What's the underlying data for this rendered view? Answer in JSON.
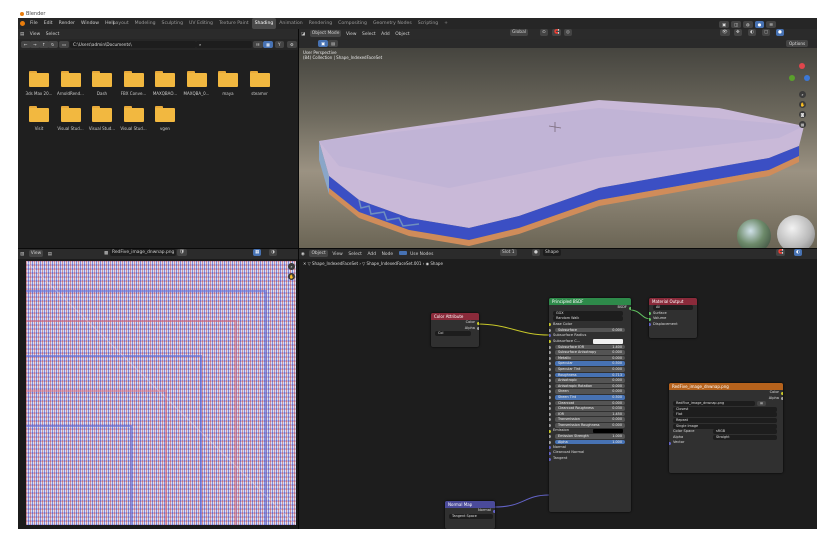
{
  "window": {
    "title": "Blender"
  },
  "menu": [
    "File",
    "Edit",
    "Render",
    "Window",
    "Help"
  ],
  "workspaces": [
    "Layout",
    "Modeling",
    "Sculpting",
    "UV Editing",
    "Texture Paint",
    "Shading",
    "Animation",
    "Rendering",
    "Compositing",
    "Geometry Nodes",
    "Scripting",
    "+"
  ],
  "active_workspace_index": 5,
  "file_browser": {
    "menu": [
      "View",
      "Select"
    ],
    "path": "C:\\Users\\admin\\Documents\\",
    "folders_row1": [
      "3ds Max 20...",
      "ArnoldRend...",
      "Dash",
      "FBX Conve...",
      "MAXQBAO...",
      "MAXQBA_0...",
      "maya",
      "steamvr"
    ],
    "folders_row2": [
      "Visit",
      "Visual Stud...",
      "Visual Stud...",
      "Visual Stud...",
      "vgen"
    ]
  },
  "viewport": {
    "mode": "Object Mode",
    "menu": [
      "View",
      "Select",
      "Add",
      "Object"
    ],
    "overlay_line1": "User Perspective",
    "overlay_line2": "(84) Collection | Shape_IndexedFaceSet",
    "global_label": "Global",
    "options_label": "Options"
  },
  "image_editor": {
    "view_label": "View",
    "image_name": "RedFive_image_dnwnap.png"
  },
  "node_editor": {
    "object_label": "Object",
    "menu": [
      "View",
      "Select",
      "Add",
      "Node"
    ],
    "use_nodes_label": "Use Nodes",
    "slot_label": "Slot 1",
    "material_label": "Shape",
    "breadcrumb": [
      "Shape_IndexedFaceSet",
      "Shape_IndexedFaceSet.001",
      "Shape"
    ],
    "color_attribute": {
      "title": "Color Attribute",
      "outputs": [
        "Color",
        "Alpha"
      ],
      "field": "Col"
    },
    "principled": {
      "title": "Principled BSDF",
      "output": "BSDF",
      "dropdowns": [
        "GGX",
        "Random Walk"
      ],
      "rows": [
        {
          "label": "Base Color",
          "kind": "socket"
        },
        {
          "label": "Subsurface",
          "value": "0.000",
          "kind": "slider"
        },
        {
          "label": "Subsurface Radius",
          "kind": "socket"
        },
        {
          "label": "Subsurface C...",
          "kind": "color"
        },
        {
          "label": "Subsurface IOR",
          "value": "1.400",
          "kind": "slider"
        },
        {
          "label": "Subsurface Anisotropy",
          "value": "0.000",
          "kind": "slider"
        },
        {
          "label": "Metallic",
          "value": "0.000",
          "kind": "slider"
        },
        {
          "label": "Specular",
          "value": "0.500",
          "kind": "slider",
          "hl": true
        },
        {
          "label": "Specular Tint",
          "value": "0.000",
          "kind": "slider"
        },
        {
          "label": "Roughness",
          "value": "0.713",
          "kind": "slider",
          "hl": true
        },
        {
          "label": "Anisotropic",
          "value": "0.000",
          "kind": "slider"
        },
        {
          "label": "Anisotropic Rotation",
          "value": "0.000",
          "kind": "slider"
        },
        {
          "label": "Sheen",
          "value": "0.000",
          "kind": "slider"
        },
        {
          "label": "Sheen Tint",
          "value": "0.500",
          "kind": "slider",
          "hl": true
        },
        {
          "label": "Clearcoat",
          "value": "0.000",
          "kind": "slider"
        },
        {
          "label": "Clearcoat Roughness",
          "value": "0.030",
          "kind": "slider"
        },
        {
          "label": "IOR",
          "value": "1.450",
          "kind": "slider"
        },
        {
          "label": "Transmission",
          "value": "0.000",
          "kind": "slider"
        },
        {
          "label": "Transmission Roughness",
          "value": "0.000",
          "kind": "slider"
        },
        {
          "label": "Emission",
          "kind": "color-dark"
        },
        {
          "label": "Emission Strength",
          "value": "1.000",
          "kind": "slider"
        },
        {
          "label": "Alpha",
          "value": "1.000",
          "kind": "slider",
          "hl": true
        },
        {
          "label": "Normal",
          "kind": "socket"
        },
        {
          "label": "Clearcoat Normal",
          "kind": "socket"
        },
        {
          "label": "Tangent",
          "kind": "socket"
        }
      ]
    },
    "material_output": {
      "title": "Material Output",
      "dropdown": "All",
      "inputs": [
        "Surface",
        "Volume",
        "Displacement"
      ]
    },
    "image_texture": {
      "title": "RedFive_image_dnwnap.png",
      "outputs": [
        "Color",
        "Alpha"
      ],
      "image_field": "RedFive_image_dnwnap.png",
      "dropdowns": [
        "Closest",
        "Flat",
        "Repeat",
        "Single Image"
      ],
      "color_space_label": "Color Space",
      "color_space_value": "sRGB",
      "alpha_label": "Alpha",
      "alpha_value": "Straight",
      "vector_label": "Vector"
    },
    "normal_map": {
      "title": "Normal Map",
      "output": "Normal",
      "dropdown": "Tangent Space"
    }
  },
  "colors": {
    "shader_header": "#2e8a4a",
    "output_header": "#8a2a3a",
    "texture_header": "#b5621c",
    "vector_header": "#4a4a9a",
    "attribute_header": "#8a2a3a",
    "folder": "#f2b840",
    "accent": "#4772b3"
  }
}
